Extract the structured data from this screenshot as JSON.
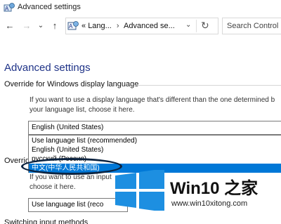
{
  "window": {
    "title": "Advanced settings"
  },
  "nav": {
    "back": "←",
    "forward": "→",
    "dropdown": "⌄",
    "up": "↑"
  },
  "address": {
    "prefix": "«",
    "crumbs": [
      "Lang...",
      "Advanced se..."
    ],
    "separator": "›",
    "dropdown": "⌄",
    "refresh": "↻"
  },
  "search": {
    "placeholder": "Search Control P"
  },
  "page": {
    "title": "Advanced settings"
  },
  "display_language": {
    "heading": "Override for Windows display language",
    "desc_line1": "If you want to use a display language that's different than the one determined b",
    "desc_line2": "your language list, choose it here.",
    "selected": "English (United States)",
    "options": [
      "Use language list (recommended)",
      "English (United States)",
      "русский (Россия)",
      "中文(中华人民共和国)"
    ],
    "highlighted_index": 3
  },
  "input_method": {
    "heading_peek": "Overrid",
    "desc_line1": "If you want to use an input",
    "desc_line2": "choose it here.",
    "selected": "Use language list (reco"
  },
  "switching": {
    "heading": "Switching input methods"
  },
  "watermark": {
    "title": "Win10 之家",
    "url": "www.win10xitong.com"
  },
  "colors": {
    "accent": "#0078d7",
    "page_title": "#1e3287",
    "win_logo": "#1d8fe1"
  }
}
